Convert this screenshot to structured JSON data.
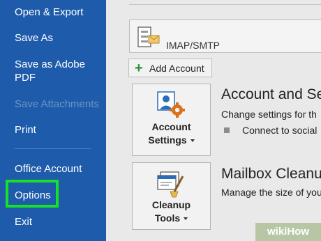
{
  "sidebar": {
    "items": [
      {
        "label": "Open & Export"
      },
      {
        "label": "Save As"
      },
      {
        "label": "Save as Adobe PDF"
      },
      {
        "label": "Save Attachments"
      },
      {
        "label": "Print"
      },
      {
        "label": "Office Account"
      },
      {
        "label": "Options"
      },
      {
        "label": "Exit"
      }
    ],
    "background": "#1e5cab",
    "highlight_color": "#18e025"
  },
  "account_selector": {
    "label": "IMAP/SMTP",
    "icon": "email-server-icon"
  },
  "add_account": {
    "label": "Add Account",
    "icon": "plus-icon"
  },
  "sections": [
    {
      "tile_line1": "Account",
      "tile_line2": "Settings",
      "tile_icon": "account-settings-icon",
      "title": "Account and Se",
      "description": "Change settings for th",
      "bullet": "Connect to social"
    },
    {
      "tile_line1": "Cleanup",
      "tile_line2": "Tools",
      "tile_icon": "cleanup-tools-icon",
      "title": "Mailbox Cleanu",
      "description": "Manage the size of you"
    }
  ],
  "watermark": "wikiHow"
}
